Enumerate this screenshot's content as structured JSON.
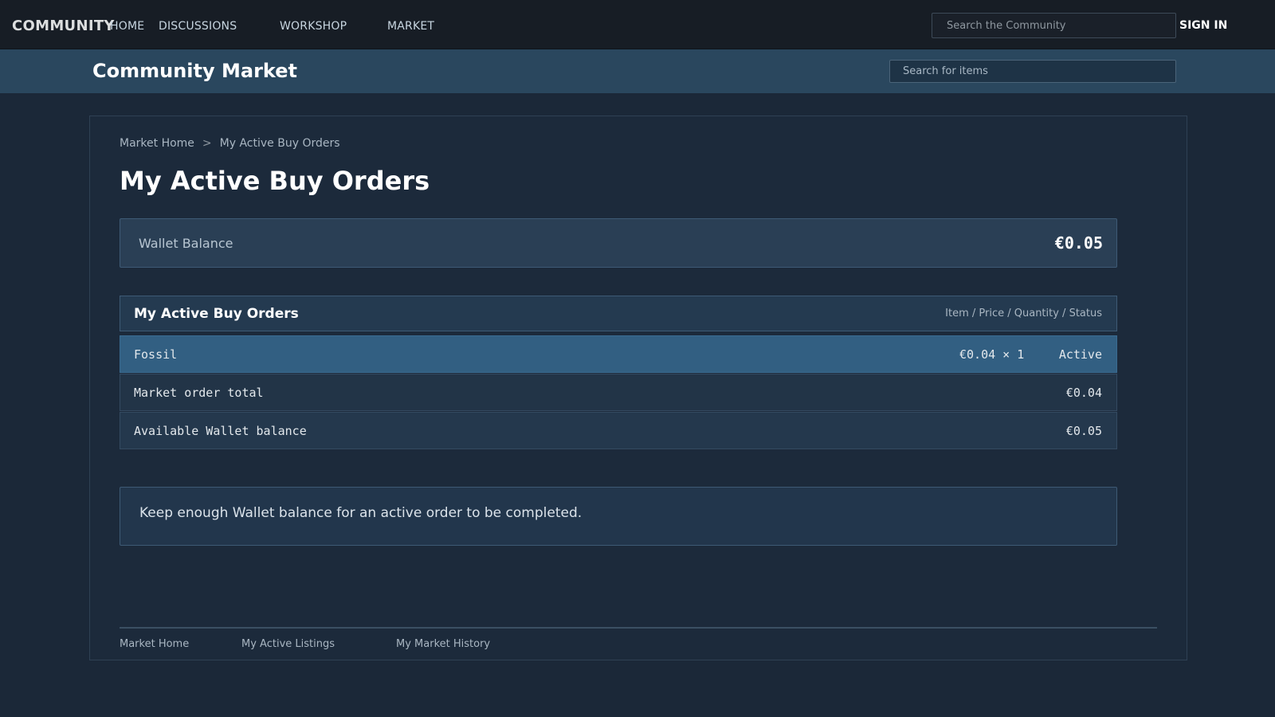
{
  "topnav": {
    "brand": "COMMUNITY",
    "links": [
      "HOME",
      "DISCUSSIONS",
      "WORKSHOP",
      "MARKET"
    ],
    "search_placeholder": "Search the Community",
    "signin_label": "SIGN IN"
  },
  "market_header": {
    "title": "Community Market",
    "search_placeholder": "Search for items"
  },
  "breadcrumb": {
    "items": [
      "Market Home",
      "My Active Buy Orders"
    ],
    "separator": ">"
  },
  "page_title": "My Active Buy Orders",
  "wallet": {
    "label": "Wallet Balance",
    "value": "€0.05"
  },
  "orders": {
    "title": "My Active Buy Orders",
    "columns": "Item / Price / Quantity / Status",
    "rows": [
      {
        "item": "Fossil",
        "price_qty": "€0.04 × 1",
        "status": "Active"
      }
    ],
    "total_label": "Market order total",
    "total_value": "€0.04",
    "available_label": "Available Wallet balance",
    "available_value": "€0.05"
  },
  "note": "Keep enough Wallet balance for an active order to be completed.",
  "footer_links": [
    "Market Home",
    "My Active Listings",
    "My Market History"
  ],
  "colors": {
    "page_bg": "#1b2838",
    "topbar_bg": "#171d25",
    "header_bg": "#2a475e",
    "selected_row": "#325f82"
  }
}
